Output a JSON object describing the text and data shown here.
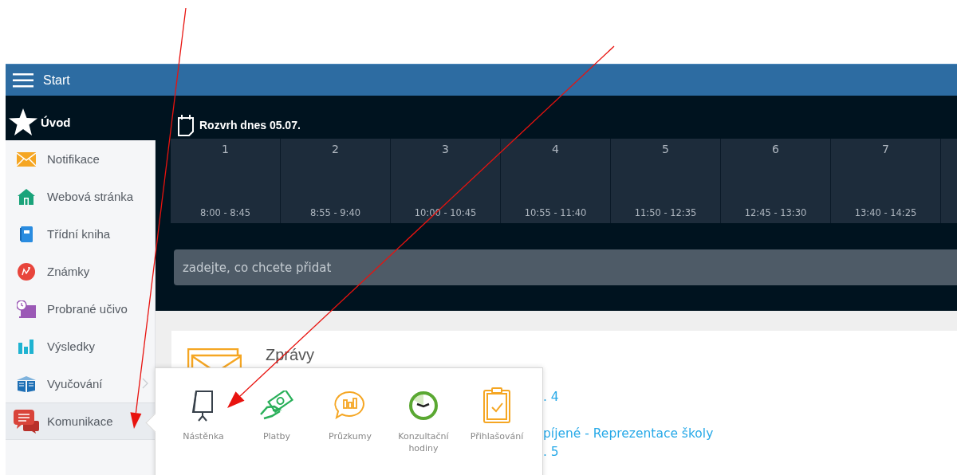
{
  "header": {
    "title": "Start"
  },
  "sidebar": {
    "home": {
      "label": "Úvod"
    },
    "items": [
      {
        "kind": "envelope",
        "label": "Notifikace",
        "selected": false,
        "chevron": false
      },
      {
        "kind": "house",
        "label": "Webová stránka",
        "selected": false,
        "chevron": false
      },
      {
        "kind": "notebook",
        "label": "Třídní kniha",
        "selected": false,
        "chevron": false
      },
      {
        "kind": "grade",
        "label": "Známky",
        "selected": false,
        "chevron": false
      },
      {
        "kind": "lesson",
        "label": "Probrané učivo",
        "selected": false,
        "chevron": false
      },
      {
        "kind": "bars",
        "label": "Výsledky",
        "selected": false,
        "chevron": false
      },
      {
        "kind": "book",
        "label": "Vyučování",
        "selected": false,
        "chevron": true
      },
      {
        "kind": "chat",
        "label": "Komunikace",
        "selected": true,
        "chevron": false
      }
    ]
  },
  "schedule": {
    "title": "Rozvrh dnes 05.07.",
    "periods": [
      {
        "number": "1",
        "time": "8:00 - 8:45"
      },
      {
        "number": "2",
        "time": "8:55 - 9:40"
      },
      {
        "number": "3",
        "time": "10:00 - 10:45"
      },
      {
        "number": "4",
        "time": "10:55 - 11:40"
      },
      {
        "number": "5",
        "time": "11:50 - 12:35"
      },
      {
        "number": "6",
        "time": "12:45 - 13:30"
      },
      {
        "number": "7",
        "time": "13:40 - 14:25"
      }
    ]
  },
  "quick_add": {
    "placeholder": "zadejte, co chcete přidat"
  },
  "news": {
    "title": "Zprávy",
    "lines": [
      ". 4",
      "píjené - Reprezentace školy",
      ". 5"
    ]
  },
  "popup": {
    "items": [
      {
        "kind": "board",
        "label": "Nástěnka"
      },
      {
        "kind": "money",
        "label": "Platby"
      },
      {
        "kind": "survey",
        "label": "Průzkumy"
      },
      {
        "kind": "clock",
        "label": "Konzultační hodiny"
      },
      {
        "kind": "clipboard",
        "label": "Přihlašování"
      }
    ]
  }
}
